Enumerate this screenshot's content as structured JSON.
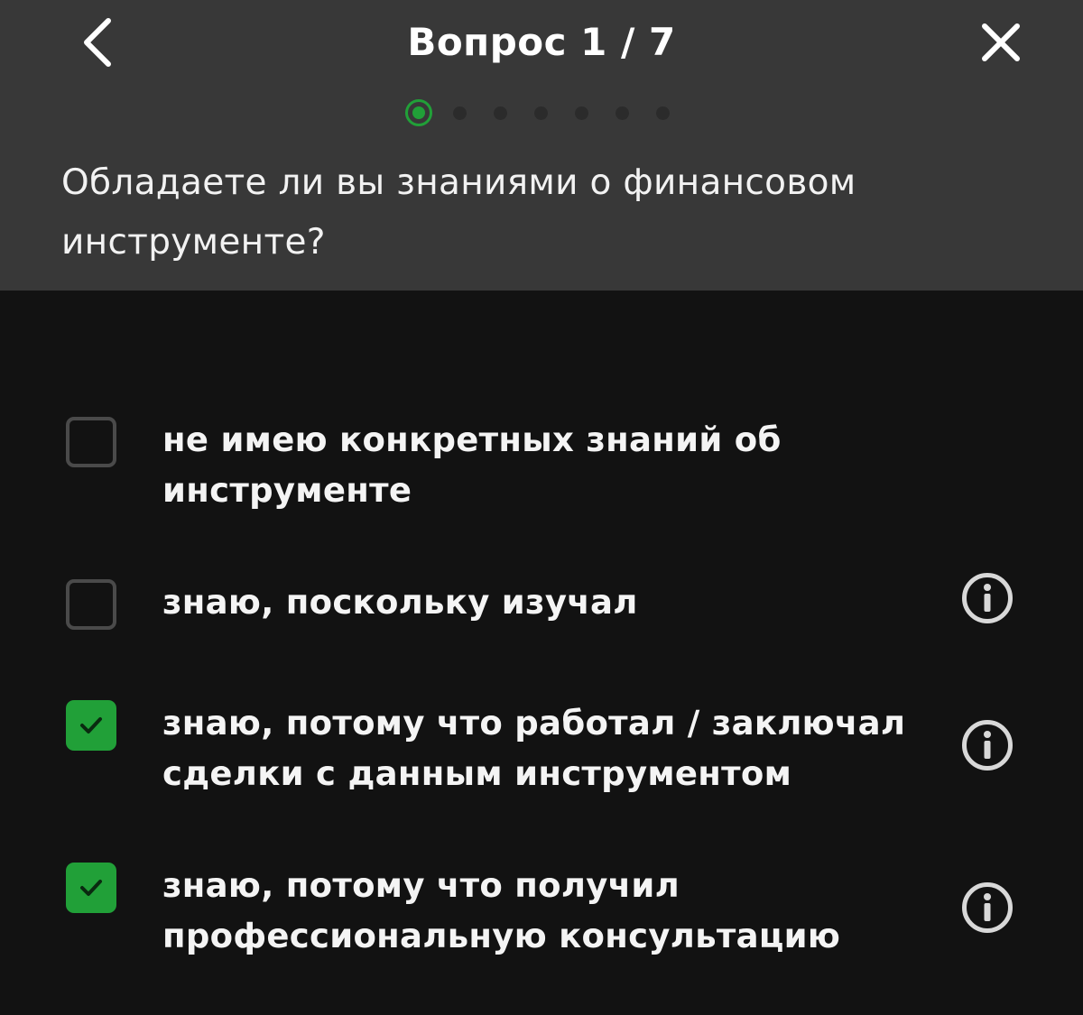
{
  "header": {
    "title": "Вопрос 1 / 7",
    "back_icon": "chevron-left-icon",
    "close_icon": "close-icon",
    "progress": {
      "current": 1,
      "total": 7
    }
  },
  "question": {
    "text": "Обладаете ли вы знаниями о финансовом инструменте?"
  },
  "options": [
    {
      "label": "не имею конкретных знаний об инструменте",
      "checked": false,
      "has_info": false
    },
    {
      "label": "знаю, поскольку изучал",
      "checked": false,
      "has_info": true
    },
    {
      "label": "знаю, потому что работал / заключал сделки с данным инструментом",
      "checked": true,
      "has_info": true
    },
    {
      "label": "знаю, потому что получил профессиональную консультацию",
      "checked": true,
      "has_info": true
    }
  ],
  "colors": {
    "accent": "#21a038",
    "header_bg": "#383838",
    "body_bg": "#121212",
    "checkbox_border": "#4a4a4a"
  }
}
